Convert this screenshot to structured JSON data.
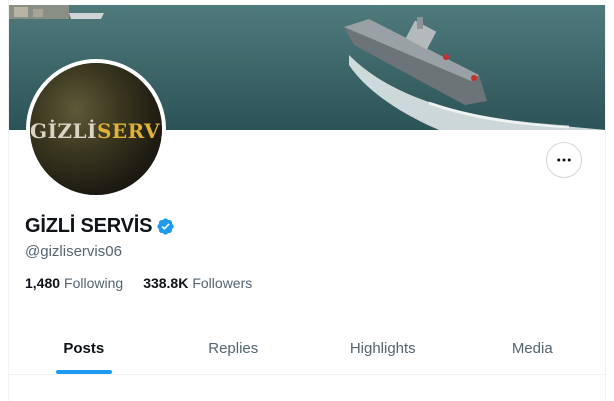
{
  "banner": {
    "description_icon": "warship-photo"
  },
  "avatar": {
    "logo_part1": "GİZLİ",
    "logo_part2": "SERVİS"
  },
  "profile": {
    "display_name": "GİZLİ SERVİS",
    "handle": "@gizliservis06",
    "verified_icon": "verified-badge-icon"
  },
  "stats": {
    "following_count": "1,480",
    "following_label": "Following",
    "followers_count": "338.8K",
    "followers_label": "Followers"
  },
  "tabs": [
    {
      "label": "Posts",
      "active": true
    },
    {
      "label": "Replies",
      "active": false
    },
    {
      "label": "Highlights",
      "active": false
    },
    {
      "label": "Media",
      "active": false
    }
  ],
  "colors": {
    "accent": "#1d9bf0",
    "text_primary": "#0f1419",
    "text_secondary": "#536471"
  }
}
